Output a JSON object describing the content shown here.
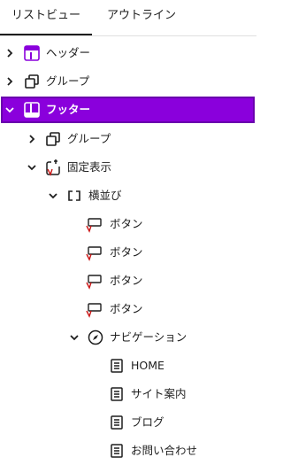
{
  "tabs": {
    "list_view": "リストビュー",
    "outline": "アウトライン"
  },
  "colors": {
    "selected_bg": "#8a00dc",
    "block_icon": "#8a00dc",
    "accent_red": "#cc1818"
  },
  "tree": {
    "header": "ヘッダー",
    "group1": "グループ",
    "footer": "フッター",
    "group2": "グループ",
    "sticky": "固定表示",
    "row": "横並び",
    "button1": "ボタン",
    "button2": "ボタン",
    "button3": "ボタン",
    "button4": "ボタン",
    "navigation": "ナビゲーション",
    "nav_home": "HOME",
    "nav_site": "サイト案内",
    "nav_blog": "ブログ",
    "nav_contact": "お問い合わせ"
  },
  "icons": {
    "header": "template-part-icon",
    "group": "group-icon",
    "footer": "template-part-icon",
    "sticky": "sticky-icon",
    "row": "row-icon",
    "button": "button-icon",
    "navigation": "compass-icon",
    "page_link": "page-icon"
  }
}
